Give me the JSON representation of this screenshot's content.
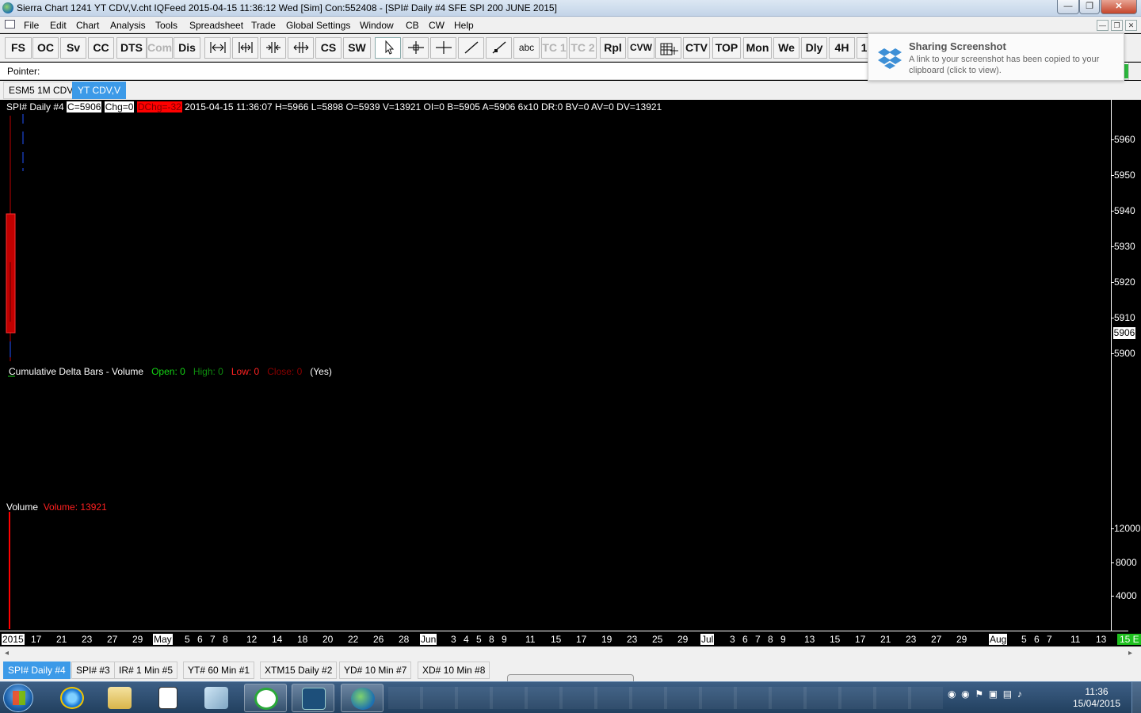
{
  "window": {
    "title": "Sierra Chart 1241 YT CDV,V.cht  IQFeed 2015-04-15  11:36:12 Wed [Sim]  Con:552408 - [SPI#  Daily  #4  SFE SPI 200 JUNE 2015]",
    "min": "—",
    "max": "❐",
    "close": "✕"
  },
  "menu": {
    "items": [
      "File",
      "Edit",
      "Chart",
      "Analysis",
      "Tools",
      "Spreadsheet",
      "Trade",
      "Global Settings",
      "Window",
      "CB",
      "CW",
      "Help"
    ]
  },
  "toolbar": {
    "buttons": [
      "FS",
      "OC",
      "Sv",
      "CC",
      "DTS",
      "Com",
      "Dis",
      "CS",
      "SW",
      "abc",
      "TC 1",
      "TC 2",
      "Rpl",
      "CVW",
      "CTV",
      "TOP",
      "Mon",
      "We",
      "Dly",
      "4H",
      "1"
    ],
    "icons": [
      "fit-width-icon",
      "expand-width-icon",
      "compress-bars-icon",
      "expand-bars-icon",
      "pointer-icon",
      "crosshair-icon",
      "cursor-cross-icon",
      "line-icon",
      "ray-icon",
      "data-table-icon"
    ]
  },
  "pointer": {
    "label": "Pointer:"
  },
  "chart_tabs": [
    "ESM5 1M CDV",
    "YT CDV,V"
  ],
  "chart_info": {
    "symbol": "SPI#  Daily  #4 ",
    "c": "C=5906",
    "chg": "Chg=0",
    "dchg": "DChg=-32",
    "rest": " 2015-04-15 11:36:07 H=5966 L=5898 O=5939 V=13921 OI=0 B=5905 A=5906 6x10 DR:0 BV=0 AV=0 DV=13921"
  },
  "study": {
    "name": "Cumulative Delta Bars - Volume",
    "open": "Open: 0",
    "high": "High: 0",
    "low": "Low: 0",
    "close": "Close: 0",
    "yes": "(Yes)"
  },
  "volume": {
    "name": "Volume",
    "value": "Volume: 13921"
  },
  "price_scale": {
    "ticks": [
      "5960",
      "5950",
      "5940",
      "5930",
      "5920",
      "5910",
      "5900"
    ],
    "last": "5906"
  },
  "volume_scale": {
    "ticks": [
      "12000",
      "8000",
      "4000"
    ]
  },
  "x_axis": {
    "labels": [
      "2015",
      "17",
      "21",
      "23",
      "27",
      "29",
      "May",
      "5",
      "6",
      "7",
      "8",
      "12",
      "14",
      "18",
      "20",
      "22",
      "26",
      "28",
      "Jun",
      "3",
      "4",
      "5",
      "8",
      "9",
      "11",
      "15",
      "17",
      "19",
      "23",
      "25",
      "29",
      "Jul",
      "3",
      "6",
      "7",
      "8",
      "9",
      "13",
      "15",
      "17",
      "21",
      "23",
      "27",
      "29",
      "Aug",
      "5",
      "6",
      "7",
      "11",
      "13",
      "15 E"
    ]
  },
  "bottom_tabs": [
    "SPI#  Daily  #4",
    "SPI#  #3",
    "IR#  1 Min  #5",
    "YT#  60 Min  #1",
    "XTM15  Daily  #2",
    "YD#  10 Min  #7",
    "XD#  10 Min  #8"
  ],
  "toast": {
    "title": "Sharing Screenshot",
    "body": "A link to your screenshot has been copied to your clipboard (click to view)."
  },
  "taskbar": {
    "time": "11:36",
    "date": "15/04/2015"
  },
  "colors": {
    "accent": "#3c9ae8",
    "candle": "#c00000",
    "volume_bar": "#ff0000",
    "green_label": "#1ec01e"
  }
}
